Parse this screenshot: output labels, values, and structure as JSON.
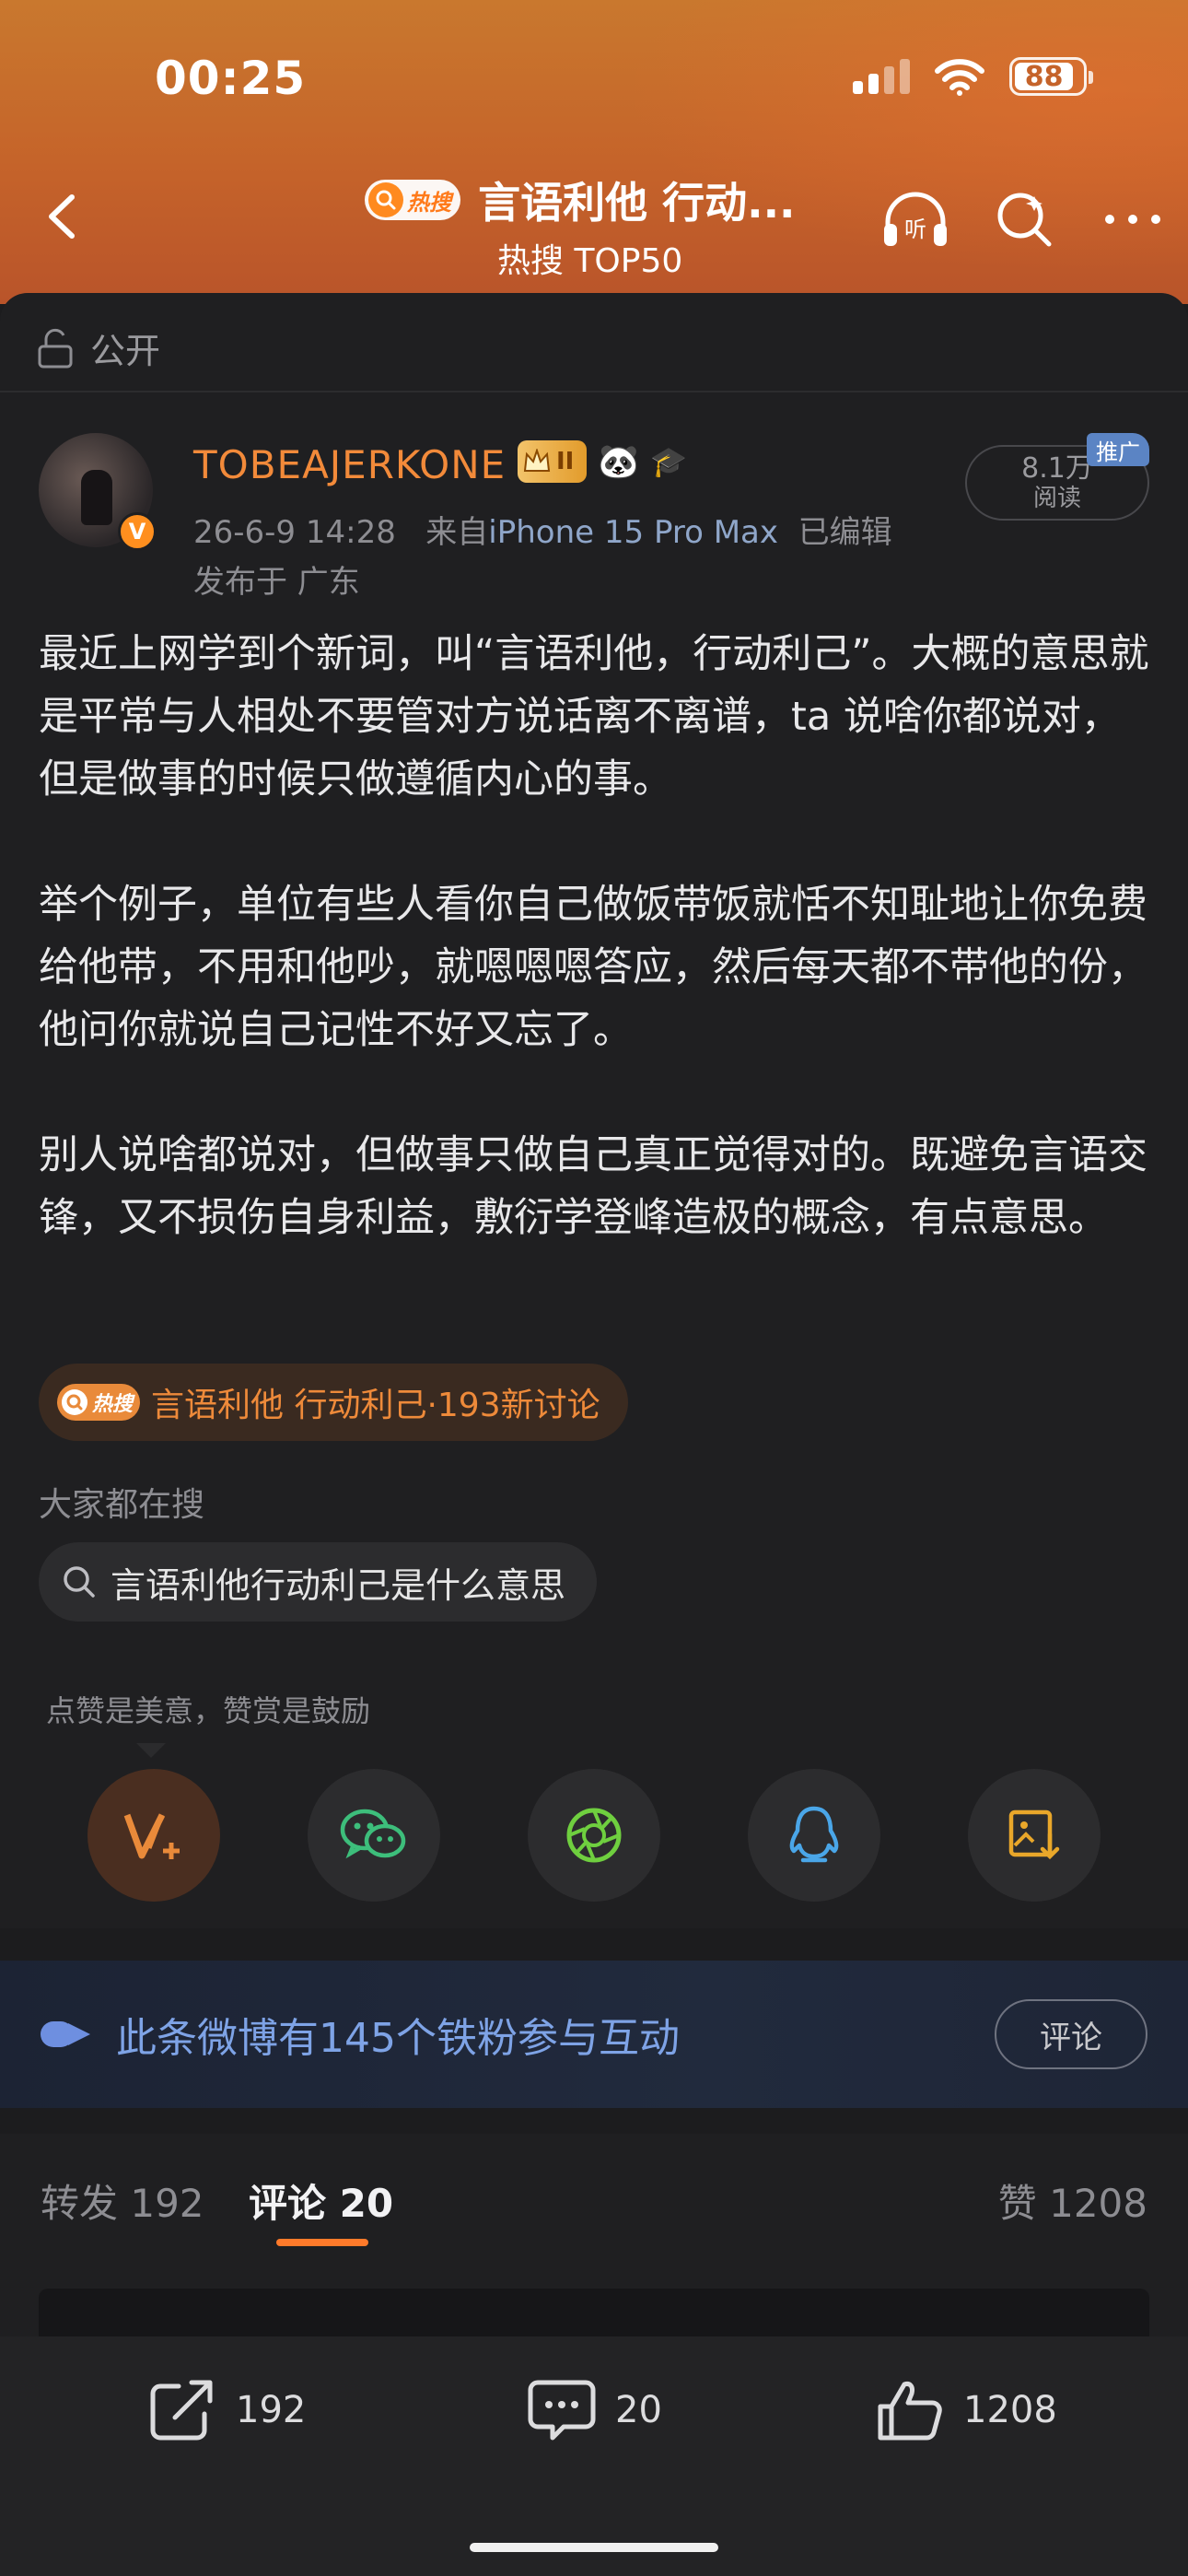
{
  "status": {
    "time": "00:25",
    "battery": "88"
  },
  "nav": {
    "hot_badge": "热搜",
    "title": "言语利他 行动...",
    "subtitle": "热搜 TOP50"
  },
  "post": {
    "visibility": "公开",
    "author": "TOBEAJERKONE",
    "level": "II",
    "date": "26-6-9 14:28",
    "source_prefix": "来自",
    "device": "iPhone 15 Pro Max",
    "edited": "已编辑",
    "location": "发布于 广东",
    "reads_count": "8.1万",
    "reads_label": "阅读",
    "promo": "推广",
    "paragraphs": [
      "最近上网学到个新词，叫“言语利他，行动利己”。大概的意思就是平常与人相处不要管对方说话离不离谱，ta 说啥你都说对，但是做事的时候只做遵循内心的事。",
      "举个例子，单位有些人看你自己做饭带饭就恬不知耻地让你免费给他带，不用和他吵，就嗯嗯嗯答应，然后每天都不带他的份，他问你就说自己记性不好又忘了。",
      "别人说啥都说对，但做事只做自己真正觉得对的。既避免言语交锋，又不损伤自身利益，敷衍学登峰造极的概念，有点意思。"
    ],
    "topic_badge": "热搜",
    "topic": "言语利他 行动利己·193新讨论",
    "search_label": "大家都在搜",
    "search_query": "言语利他行动利己是什么意思",
    "praise_tip": "点赞是美意，赞赏是鼓励"
  },
  "fans_banner": {
    "text": "此条微博有145个铁粉参与互动",
    "button": "评论"
  },
  "tabs": {
    "repost": "转发 192",
    "comments": "评论 20",
    "likes": "赞 1208"
  },
  "bottom": {
    "repost": "192",
    "comment": "20",
    "like": "1208"
  },
  "colors": {
    "accent": "#ff7a2a",
    "username": "#f28a3a",
    "link_blue": "#7ea3e6"
  }
}
